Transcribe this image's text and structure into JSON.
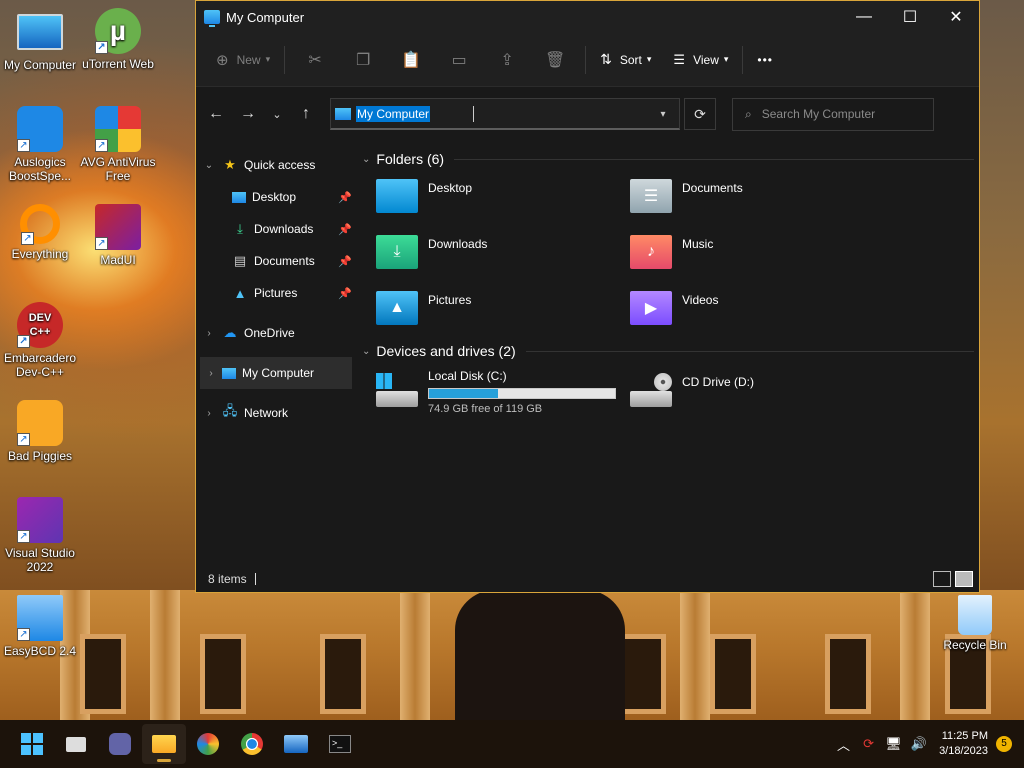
{
  "desktop": {
    "icons": [
      {
        "label": "My Computer",
        "icon": "my-computer-icon"
      },
      {
        "label": "uTorrent Web",
        "icon": "utorrent-icon"
      },
      {
        "label": "Auslogics BoostSpe...",
        "icon": "auslogics-icon"
      },
      {
        "label": "AVG AntiVirus Free",
        "icon": "avg-icon"
      },
      {
        "label": "Everything",
        "icon": "everything-icon"
      },
      {
        "label": "MadUI",
        "icon": "madui-icon"
      },
      {
        "label": "Embarcadero Dev-C++",
        "icon": "devcpp-icon"
      },
      {
        "label": "Bad Piggies",
        "icon": "bad-piggies-icon"
      },
      {
        "label": "Visual Studio 2022",
        "icon": "visual-studio-icon"
      },
      {
        "label": "EasyBCD 2.4",
        "icon": "easybcd-icon"
      },
      {
        "label": "Recycle Bin",
        "icon": "recycle-bin-icon"
      }
    ],
    "devcpp_text": "DEV C++"
  },
  "window": {
    "title": "My Computer",
    "controls": {
      "minimize": "—",
      "maximize": "☐",
      "close": "✕"
    }
  },
  "toolbar": {
    "new_label": "New",
    "sort_label": "Sort",
    "view_label": "View",
    "more_label": "•••"
  },
  "address": {
    "path": "My Computer",
    "search_placeholder": "Search My Computer"
  },
  "nav": {
    "quick_access": "Quick access",
    "pinned": [
      "Desktop",
      "Downloads",
      "Documents",
      "Pictures"
    ],
    "onedrive": "OneDrive",
    "my_computer": "My Computer",
    "network": "Network"
  },
  "content": {
    "folders_header": "Folders (6)",
    "folders": [
      "Desktop",
      "Documents",
      "Downloads",
      "Music",
      "Pictures",
      "Videos"
    ],
    "drives_header": "Devices and drives (2)",
    "drives": [
      {
        "name": "Local Disk (C:)",
        "free_text": "74.9 GB free of 119 GB",
        "used_fraction": 0.37
      },
      {
        "name": "CD Drive (D:)"
      }
    ]
  },
  "status": {
    "items": "8 items"
  },
  "taskbar": {
    "apps": [
      "start-icon",
      "task-view-icon",
      "teams-chat-icon",
      "file-explorer-icon",
      "paint-icon",
      "chrome-icon",
      "photos-icon",
      "terminal-icon"
    ],
    "time": "11:25 PM",
    "date": "3/18/2023",
    "notifications": "5"
  },
  "colors": {
    "accent": "#0078d4",
    "window_border": "#d9a53a",
    "window_bg": "#191919",
    "progress": "#26a0da"
  }
}
